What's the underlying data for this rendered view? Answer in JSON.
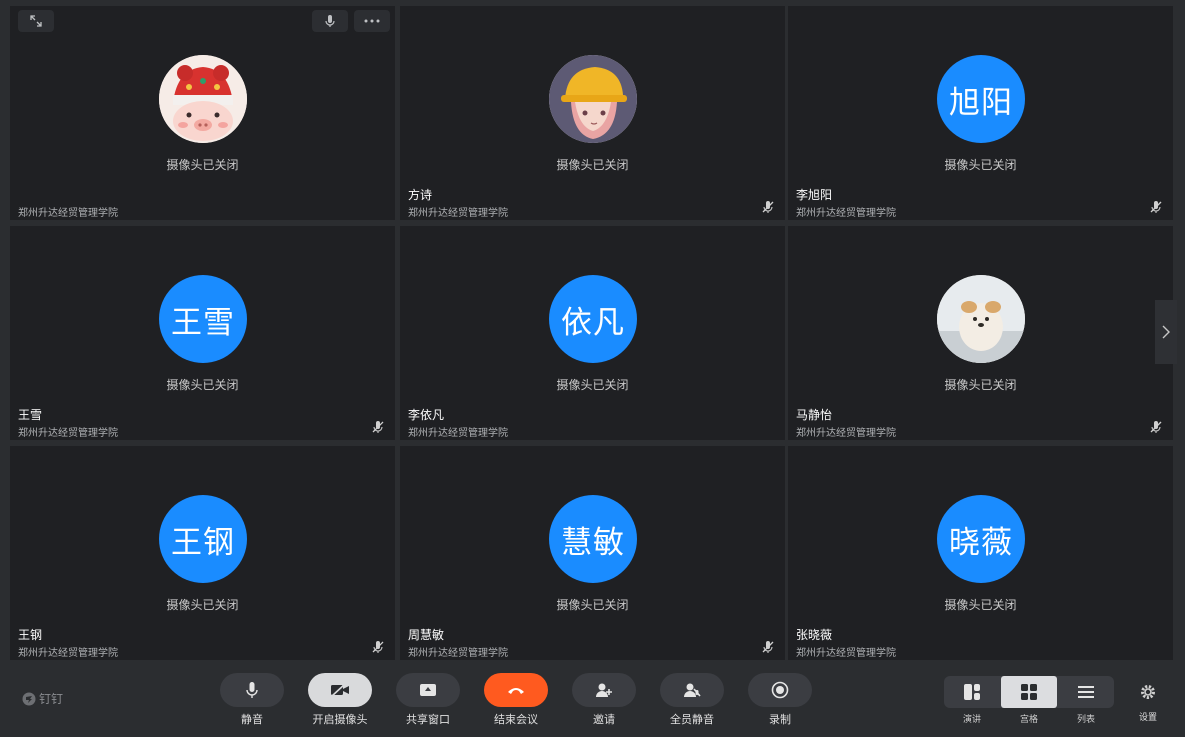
{
  "tiles": [
    {
      "name": "",
      "org": "郑州升达经贸管理学院",
      "camera_status": "摄像头已关闭",
      "avatar_text": "",
      "avatar_type": "image-pig",
      "muted": false
    },
    {
      "name": "方诗",
      "org": "郑州升达经贸管理学院",
      "camera_status": "摄像头已关闭",
      "avatar_text": "",
      "avatar_type": "image-girl",
      "muted": true
    },
    {
      "name": "李旭阳",
      "org": "郑州升达经贸管理学院",
      "camera_status": "摄像头已关闭",
      "avatar_text": "旭阳",
      "avatar_type": "text",
      "muted": true
    },
    {
      "name": "王雪",
      "org": "郑州升达经贸管理学院",
      "camera_status": "摄像头已关闭",
      "avatar_text": "王雪",
      "avatar_type": "text",
      "muted": true
    },
    {
      "name": "李依凡",
      "org": "郑州升达经贸管理学院",
      "camera_status": "摄像头已关闭",
      "avatar_text": "依凡",
      "avatar_type": "text",
      "muted": false
    },
    {
      "name": "马静怡",
      "org": "郑州升达经贸管理学院",
      "camera_status": "摄像头已关闭",
      "avatar_text": "",
      "avatar_type": "image-dog",
      "muted": true
    },
    {
      "name": "王钢",
      "org": "郑州升达经贸管理学院",
      "camera_status": "摄像头已关闭",
      "avatar_text": "王钢",
      "avatar_type": "text",
      "muted": true
    },
    {
      "name": "周慧敏",
      "org": "郑州升达经贸管理学院",
      "camera_status": "摄像头已关闭",
      "avatar_text": "慧敏",
      "avatar_type": "text",
      "muted": true
    },
    {
      "name": "张晓薇",
      "org": "郑州升达经贸管理学院",
      "camera_status": "摄像头已关闭",
      "avatar_text": "晓薇",
      "avatar_type": "text",
      "muted": false
    }
  ],
  "brand": {
    "label": "钉钉",
    "icon": "dingtalk-logo-icon"
  },
  "toolbar": {
    "mute_label": "静音",
    "camera_label": "开启摄像头",
    "share_label": "共享窗口",
    "end_label": "结束会议",
    "invite_label": "邀请",
    "mute_all_label": "全员静音",
    "record_label": "录制",
    "end_color": "#ff5a1f"
  },
  "views": {
    "speaker_label": "演讲",
    "grid_label": "宫格",
    "list_label": "列表",
    "selected": "宫格"
  },
  "settings_label": "设置",
  "accent_color": "#1a8cff"
}
